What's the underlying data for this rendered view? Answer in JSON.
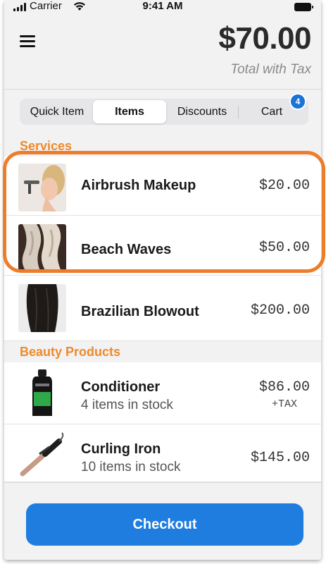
{
  "status_bar": {
    "carrier": "Carrier",
    "time": "9:41 AM"
  },
  "header": {
    "total": "$70.00",
    "total_label": "Total with Tax"
  },
  "tabs": [
    {
      "label": "Quick Item"
    },
    {
      "label": "Items",
      "active": true
    },
    {
      "label": "Discounts"
    },
    {
      "label": "Cart",
      "badge": "4"
    }
  ],
  "sections": [
    {
      "title": "Services",
      "items": [
        {
          "name": "Airbrush Makeup",
          "price": "$20.00"
        },
        {
          "name": "Beach Waves",
          "price": "$50.00"
        },
        {
          "name": "Brazilian Blowout",
          "price": "$200.00"
        }
      ]
    },
    {
      "title": "Beauty Products",
      "items": [
        {
          "name": "Conditioner",
          "stock": "4 items in stock",
          "price": "$86.00",
          "tax": "+TAX"
        },
        {
          "name": "Curling Iron",
          "stock": "10 items in stock",
          "price": "$145.00"
        }
      ]
    }
  ],
  "checkout": {
    "label": "Checkout"
  },
  "colors": {
    "accent": "#1f7de0",
    "section_header": "#ee8a2a",
    "highlight": "#ee7d2b",
    "badge": "#1a73d6"
  }
}
